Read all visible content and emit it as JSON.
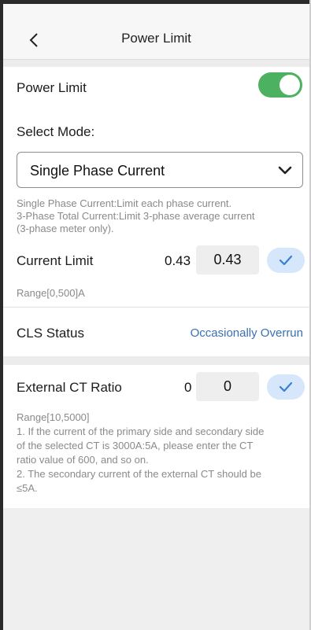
{
  "header": {
    "title": "Power Limit",
    "back_icon": "chevron-left-icon"
  },
  "power_limit": {
    "label": "Power Limit",
    "enabled": true,
    "toggle_color": "#4cb160"
  },
  "mode": {
    "label": "Select Mode:",
    "selected": "Single Phase Current",
    "help_line1": "Single Phase Current:Limit each phase current.",
    "help_line2": "3-Phase Total Current:Limit 3-phase average current",
    "help_line3": "(3-phase meter only)."
  },
  "current_limit": {
    "label": "Current Limit",
    "current_value": "0.43",
    "input_value": "0.43",
    "range": "Range[0,500]A"
  },
  "cls_status": {
    "label": "CLS Status",
    "value": "Occasionally Overrun",
    "value_color": "#3a6fb3"
  },
  "ct_ratio": {
    "label": "External CT Ratio",
    "current_value": "0",
    "input_value": "0",
    "range": "Range[10,5000]",
    "note1_line1": "1. If the current of the primary side and secondary side",
    "note1_line2": "of the selected CT is 3000A:5A, please enter the CT",
    "note1_line3": "ratio value of 600, and so on.",
    "note2_line1": "2. The secondary current of the external CT should be",
    "note2_line2": "≤5A."
  },
  "accent_color": "#d6e7fb"
}
